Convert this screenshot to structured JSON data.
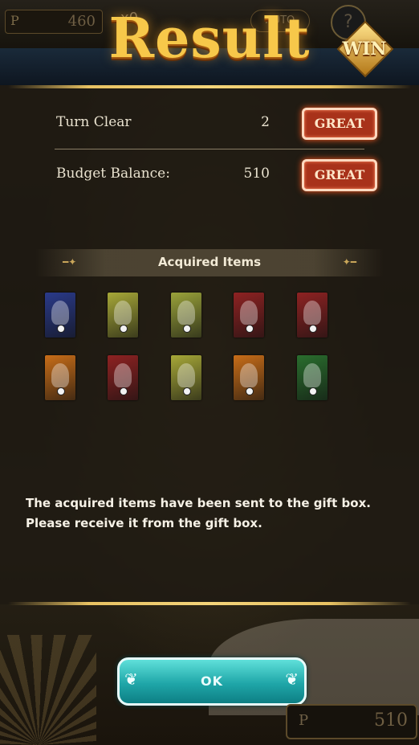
{
  "hud": {
    "points_symbol": "P",
    "points_value": "460",
    "item_count": "x0",
    "auto_label": "AUTO",
    "help_label": "?",
    "bottom_points_symbol": "P",
    "bottom_points_value": "510"
  },
  "result": {
    "title": "Result",
    "badge": "WIN"
  },
  "scores": [
    {
      "label": "Turn Clear",
      "value": "2",
      "grade": "GREAT"
    },
    {
      "label": "Budget Balance:",
      "value": "510",
      "grade": "GREAT"
    }
  ],
  "acquired": {
    "title": "Acquired Items",
    "items": [
      {
        "name": "card-1",
        "color": "#2a3a8a"
      },
      {
        "name": "card-2",
        "color": "#a7a838"
      },
      {
        "name": "card-3",
        "color": "#9aa23a"
      },
      {
        "name": "card-4",
        "color": "#8e2222"
      },
      {
        "name": "card-5",
        "color": "#8e2222"
      },
      {
        "name": "card-6",
        "color": "#c86d18"
      },
      {
        "name": "card-7",
        "color": "#8e2222"
      },
      {
        "name": "card-8",
        "color": "#a7a838"
      },
      {
        "name": "card-9",
        "color": "#c86d18"
      },
      {
        "name": "card-10",
        "color": "#2a6e2e"
      }
    ]
  },
  "message": {
    "line1": "The acquired items have been sent to the gift box.",
    "line2": "Please receive it from the gift box."
  },
  "ok_button": {
    "label": "OK"
  },
  "colors": {
    "great_red": "#a8321a",
    "ok_teal": "#1fa6a8",
    "title_gold": "#f7c84a"
  }
}
